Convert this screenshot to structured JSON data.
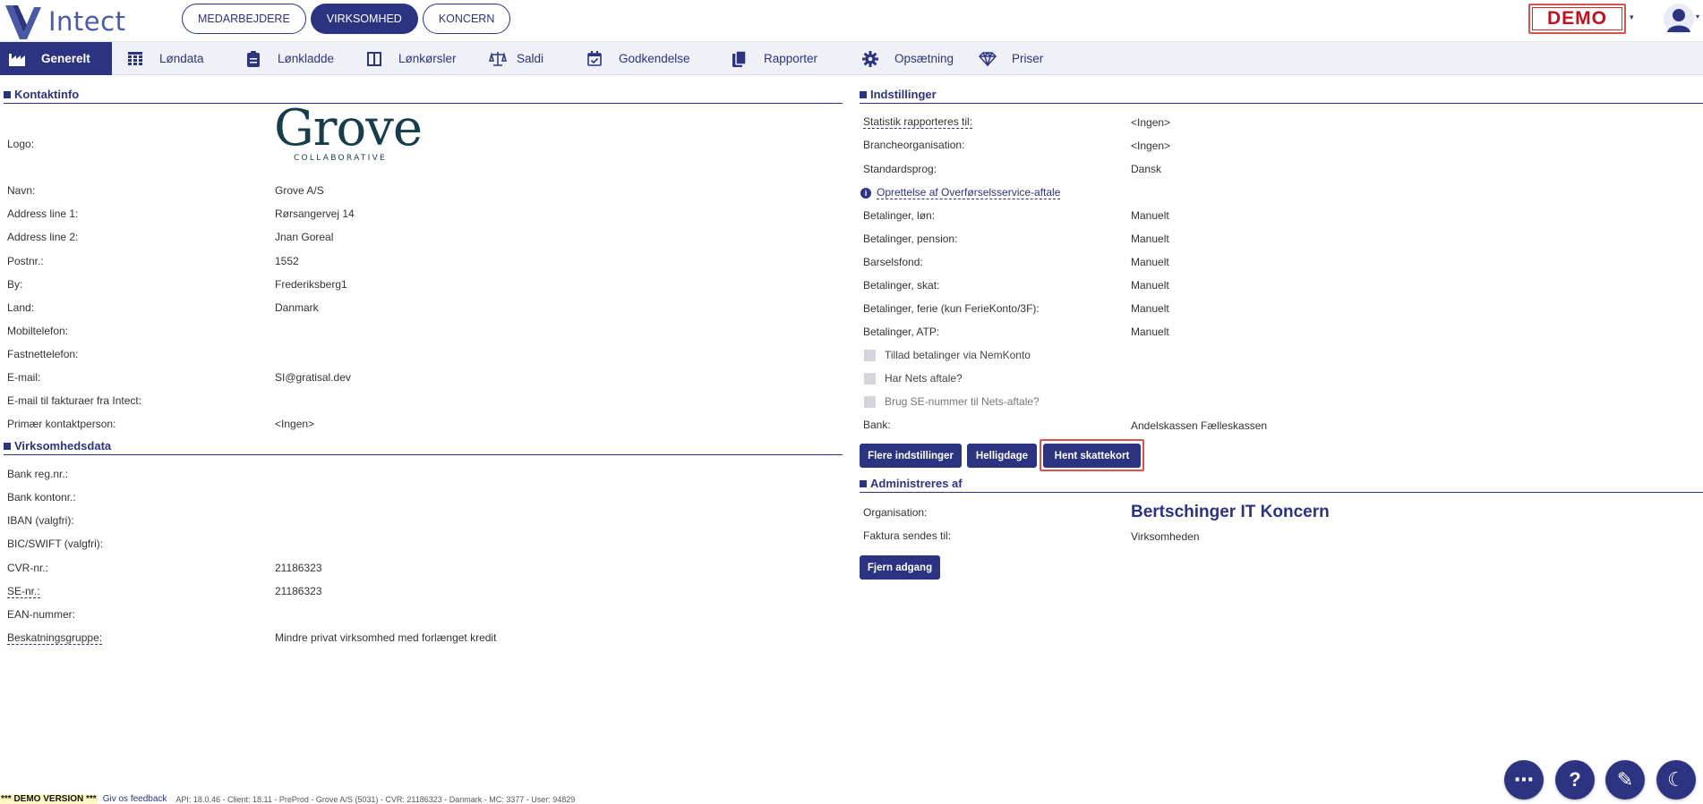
{
  "header": {
    "logo_text": "Intect",
    "scope_tabs": [
      {
        "label": "MEDARBEJDERE",
        "active": false
      },
      {
        "label": "VIRKSOMHED",
        "active": true
      },
      {
        "label": "KONCERN",
        "active": false
      }
    ],
    "demo_badge": "DEMO"
  },
  "nav": {
    "items": [
      {
        "label": "Generelt",
        "icon": "factory-icon",
        "active": true
      },
      {
        "label": "Løndata",
        "icon": "grid-icon"
      },
      {
        "label": "Lønkladde",
        "icon": "clipboard-icon"
      },
      {
        "label": "Lønkørsler",
        "icon": "columns-icon"
      },
      {
        "label": "Saldi",
        "icon": "scale-icon"
      },
      {
        "label": "Godkendelse",
        "icon": "calendar-check-icon"
      },
      {
        "label": "Rapporter",
        "icon": "documents-icon"
      },
      {
        "label": "Opsætning",
        "icon": "gear-icon"
      },
      {
        "label": "Priser",
        "icon": "diamond-icon"
      }
    ]
  },
  "kontaktinfo": {
    "title": "Kontaktinfo",
    "logo_label": "Logo:",
    "company_logo": {
      "word": "Grove",
      "sub": "COLLABORATIVE"
    },
    "rows": [
      {
        "label": "Navn:",
        "value": "Grove A/S"
      },
      {
        "label": "Address line 1:",
        "value": "Rørsangervej 14"
      },
      {
        "label": "Address line 2:",
        "value": "Jnan Goreal"
      },
      {
        "label": "Postnr.:",
        "value": "1552"
      },
      {
        "label": "By:",
        "value": "Frederiksberg1"
      },
      {
        "label": "Land:",
        "value": "Danmark"
      },
      {
        "label": "Mobiltelefon:",
        "value": ""
      },
      {
        "label": "Fastnettelefon:",
        "value": ""
      },
      {
        "label": "E-mail:",
        "value": "SI@gratisal.dev"
      },
      {
        "label": "E-mail til fakturaer fra Intect:",
        "value": ""
      },
      {
        "label": "Primær kontaktperson:",
        "value": "<Ingen>"
      }
    ]
  },
  "virksomhedsdata": {
    "title": "Virksomhedsdata",
    "rows": [
      {
        "label": "Bank reg.nr.:",
        "value": ""
      },
      {
        "label": "Bank kontonr.:",
        "value": ""
      },
      {
        "label": "IBAN (valgfri):",
        "value": ""
      },
      {
        "label": "BIC/SWIFT (valgfri):",
        "value": ""
      },
      {
        "label": "CVR-nr.:",
        "value": "21186323"
      },
      {
        "label": "SE-nr.:",
        "value": "21186323"
      },
      {
        "label": "EAN-nummer:",
        "value": ""
      },
      {
        "label": "Beskatningsgruppe:",
        "value": "Mindre privat virksomhed med forlænget kredit"
      }
    ]
  },
  "indstillinger": {
    "title": "Indstillinger",
    "rows_top": [
      {
        "label": "Statistik rapporteres til:",
        "value": "<Ingen>"
      },
      {
        "label": "Brancheorganisation:",
        "value": "<Ingen>"
      },
      {
        "label": "Standardsprog:",
        "value": "Dansk"
      }
    ],
    "info_link": "Oprettelse af Overførselsservice-aftale",
    "rows_payments": [
      {
        "label": "Betalinger, løn:",
        "value": "Manuelt"
      },
      {
        "label": "Betalinger, pension:",
        "value": "Manuelt"
      },
      {
        "label": "Barselsfond:",
        "value": "Manuelt"
      },
      {
        "label": "Betalinger, skat:",
        "value": "Manuelt"
      },
      {
        "label": "Betalinger, ferie (kun FerieKonto/3F):",
        "value": "Manuelt"
      },
      {
        "label": "Betalinger, ATP:",
        "value": "Manuelt"
      }
    ],
    "checkboxes": [
      {
        "label": "Tillad betalinger via NemKonto",
        "checked": false
      },
      {
        "label": "Har Nets aftale?",
        "checked": false
      },
      {
        "label": "Brug SE-nummer til Nets-aftale?",
        "checked": false
      }
    ],
    "bank": {
      "label": "Bank:",
      "value": "Andelskassen Fælleskassen"
    },
    "buttons": {
      "more": "Flere indstillinger",
      "holidays": "Helligdage",
      "taxcard": "Hent skattekort"
    }
  },
  "administreres": {
    "title": "Administreres af",
    "org_label": "Organisation:",
    "org_value": "Bertschinger IT Koncern",
    "invoice_label": "Faktura sendes til:",
    "invoice_value": "Virksomheden",
    "remove_button": "Fjern adgang"
  },
  "footer": {
    "demo_version": "*** DEMO VERSION ***",
    "feedback": "Giv os feedback",
    "meta": "API: 18.0.46 - Client: 18.11 - PreProd  - Grove A/S (5031) - CVR: 21186323 - Danmark - MC: 3377  - User: 94829"
  },
  "fab": {
    "more": "⋯",
    "help": "?",
    "edit": "✎",
    "theme": "☾"
  },
  "colors": {
    "primary": "#2c3481",
    "nav_bg": "#eff1f6",
    "demo_red": "#c0121e",
    "highlight": "#e0504c"
  }
}
